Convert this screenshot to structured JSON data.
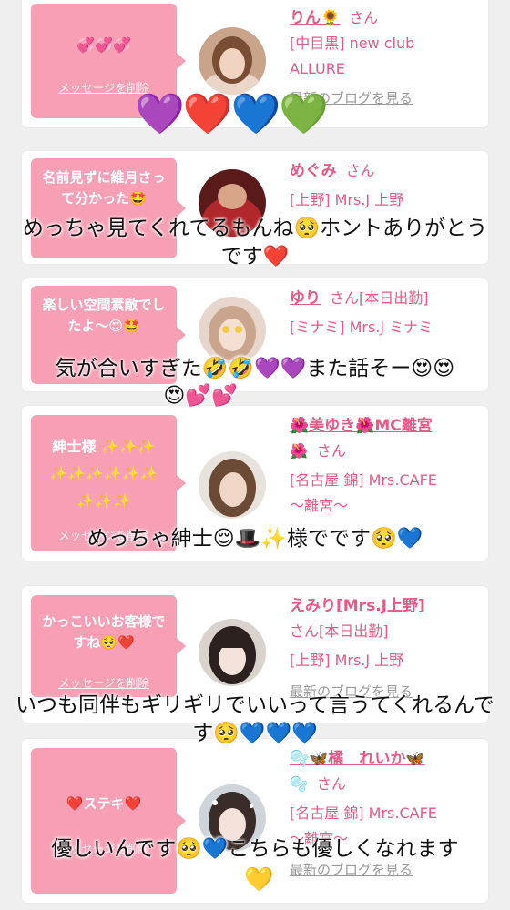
{
  "colors": {
    "accent": "#e75a85",
    "bubble": "#f7a0b5",
    "background": "#efefef"
  },
  "delete_label": "メッセージを削除",
  "blog_label": "最新のブログを見る",
  "san": "さん",
  "cards": [
    {
      "message": "💞💞💞",
      "name": "りん🌻",
      "lines": [
        "[中目黒] new club",
        "ALLURE"
      ]
    },
    {
      "message": "名前見ずに維月さって分かった🤩",
      "name": "めぐみ",
      "lines": [
        "[上野] Mrs.J 上野"
      ]
    },
    {
      "message": "楽しい空間素敵でしたよ〜😍🤩",
      "name": "ゆり",
      "san_suffix": "[本日出勤]",
      "lines": [
        "[ミナミ] Mrs.J ミナミ"
      ]
    },
    {
      "message": "紳士様 ✨✨✨✨✨✨✨✨✨✨✨✨",
      "name": "🌺美ゆき🌺MC離宮",
      "name_line2": "🌺",
      "lines": [
        "[名古屋 錦] Mrs.CAFE",
        "〜離宮〜"
      ]
    },
    {
      "message": "かっこいいお客様ですね🥺❤️",
      "name": "えみり[Mrs.J上野]",
      "san_suffix": "[本日出勤]",
      "lines": [
        "[上野] Mrs.J 上野"
      ]
    },
    {
      "message": "❤️ステキ❤️",
      "name": "🫧🦋橘　れいか🦋",
      "name_line2": "🫧",
      "lines": [
        "[名古屋 錦] Mrs.CAFE",
        "〜離宮〜"
      ]
    }
  ],
  "overlays": {
    "hearts_row": "💜❤️💙💚",
    "caption1": "めっちゃ見てくれてるもんね🥺ホントありがとうです❤️",
    "caption2a": "気が合いすぎた🤣🤣💜💜また話そー😍😍",
    "caption2b": "😍💕💕",
    "caption3": "めっちゃ紳士😌🎩✨様でです🥺💙",
    "caption4": "いつも同伴もギリギリでいいって言うてくれるんです🥺💙💙💙",
    "caption5": "優しいんです🥺💙こちらも優しくなれます",
    "yellow_heart": "💛"
  }
}
